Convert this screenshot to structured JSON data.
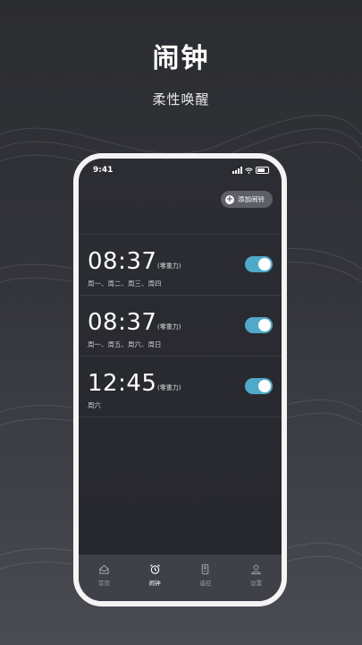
{
  "promo": {
    "title": "闹钟",
    "subtitle": "柔性唤醒"
  },
  "status_bar": {
    "time": "9:41"
  },
  "header": {
    "add_button_label": "添加闹铃"
  },
  "alarms": [
    {
      "time": "08:37",
      "tag": "(零重力)",
      "days": "周一、周二、周三、周四",
      "enabled": true
    },
    {
      "time": "08:37",
      "tag": "(零重力)",
      "days": "周一、周五、周六、周日",
      "enabled": true
    },
    {
      "time": "12:45",
      "tag": "(零重力)",
      "days": "周六",
      "enabled": true
    }
  ],
  "tabbar": {
    "items": [
      {
        "label": "首页",
        "icon": "home-icon",
        "active": false
      },
      {
        "label": "闹钟",
        "icon": "alarm-clock-icon",
        "active": true
      },
      {
        "label": "遥控",
        "icon": "remote-icon",
        "active": false
      },
      {
        "label": "设置",
        "icon": "user-icon",
        "active": false
      }
    ]
  },
  "colors": {
    "toggle_on": "#4fa9c9",
    "tabbar_bg": "#3f4048"
  }
}
